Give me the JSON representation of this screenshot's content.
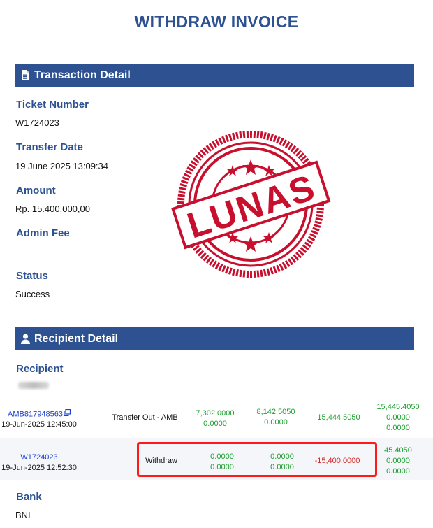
{
  "invoice": {
    "title": "WITHDRAW INVOICE"
  },
  "transaction": {
    "section_title": "Transaction Detail",
    "ticket_label": "Ticket Number",
    "ticket_value": "W1724023",
    "date_label": "Transfer Date",
    "date_value": "19 June 2025 13:09:34",
    "amount_label": "Amount",
    "amount_value": "Rp. 15.400.000,00",
    "fee_label": "Admin Fee",
    "fee_value": "-",
    "status_label": "Status",
    "status_value": "Success"
  },
  "stamp": {
    "text": "LUNAS",
    "color": "#c8102e"
  },
  "recipient": {
    "section_title": "Recipient Detail",
    "recipient_label": "Recipient",
    "bank_label": "Bank",
    "bank_value": "BNI"
  },
  "ledger": {
    "rows": [
      {
        "ticket": "AMB817948563",
        "datetime": "19-Jun-2025 12:45:00",
        "type": "Transfer Out - AMB",
        "col1": [
          "7,302.0000",
          "0.0000"
        ],
        "col2": [
          "8,142.5050",
          "0.0000"
        ],
        "col3": "15,444.5050",
        "col4": [
          "15,445.4050",
          "0.0000",
          "0.0000"
        ]
      },
      {
        "ticket": "W1724023",
        "datetime": "19-Jun-2025 12:52:30",
        "type": "Withdraw",
        "col1": [
          "0.0000",
          "0.0000"
        ],
        "col2": [
          "0.0000",
          "0.0000"
        ],
        "col3": "-15,400.0000",
        "col4": [
          "45.4050",
          "0.0000",
          "0.0000"
        ]
      }
    ],
    "colors": {
      "positive": "#1e9e2e",
      "negative": "#d22626",
      "link": "#1a3fcf",
      "highlight": "#ff1a1a"
    }
  }
}
